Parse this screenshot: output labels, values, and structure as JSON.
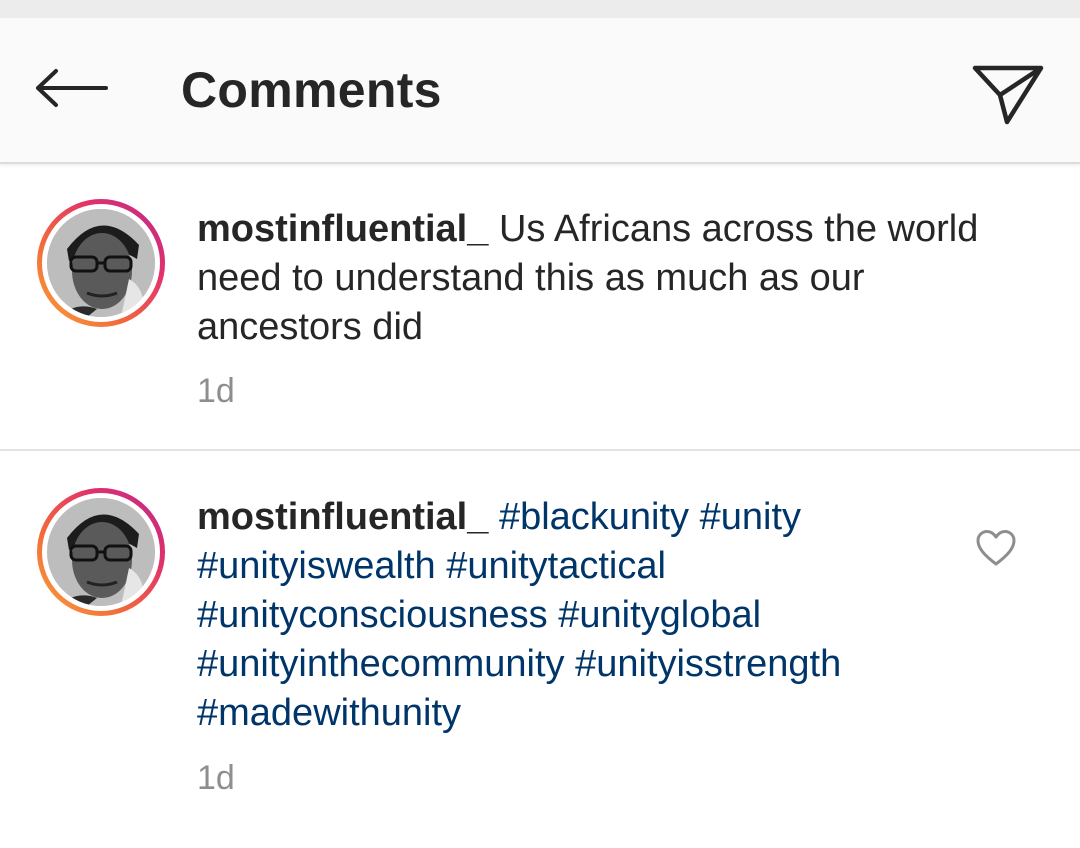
{
  "header": {
    "title": "Comments",
    "back_icon": "arrow-left-icon",
    "send_icon": "paper-plane-icon"
  },
  "comments": [
    {
      "username": "mostinfluential_",
      "text": "Us Africans across the world need to understand this as much as our ancestors did",
      "time": "1d"
    },
    {
      "username": "mostinfluential_",
      "hashtags": [
        "#blackunity",
        "#unity",
        "#unityiswealth",
        "#unitytactical",
        "#unityconsciousness",
        "#unityglobal",
        "#unityinthecommunity",
        "#unityisstrength",
        "#madewithunity"
      ],
      "time": "1d",
      "like_icon": "heart-outline-icon"
    }
  ],
  "colors": {
    "text": "#262626",
    "hashtag": "#003569",
    "muted": "#8e8e8e",
    "header_bg": "#fafafa"
  }
}
